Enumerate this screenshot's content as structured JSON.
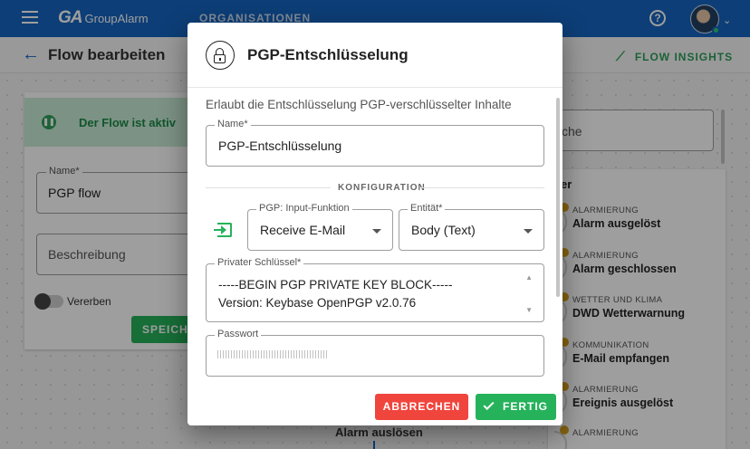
{
  "topbar": {
    "logo_mark": "GA",
    "logo_word": "GroupAlarm",
    "org_label": "ORGANISATIONEN",
    "help_glyph": "?",
    "avatar_caret": "⌄"
  },
  "subheader": {
    "back_glyph": "←",
    "title": "Flow bearbeiten",
    "insights_label": "FLOW INSIGHTS",
    "insights_glyph": "⟋"
  },
  "background": {
    "active_banner": "Der Flow ist aktiv",
    "name_label": "Name*",
    "name_value": "PGP flow",
    "desc_placeholder": "Beschreibung",
    "inherit_label": "Vererben",
    "save_label": "SPEICH",
    "search_partial": "che",
    "triggers_header": "er",
    "triggers": [
      {
        "category": "ALARMIERUNG",
        "name": "Alarm ausgelöst"
      },
      {
        "category": "ALARMIERUNG",
        "name": "Alarm geschlossen"
      },
      {
        "category": "WETTER UND KLIMA",
        "name": "DWD Wetterwarnung"
      },
      {
        "category": "KOMMUNIKATION",
        "name": "E-Mail empfangen"
      },
      {
        "category": "ALARMIERUNG",
        "name": "Ereignis ausgelöst"
      },
      {
        "category": "ALARMIERUNG",
        "name": ""
      }
    ],
    "node_label": "Alarm auslösen"
  },
  "dialog": {
    "title": "PGP-Entschlüsselung",
    "description": "Erlaubt die Entschlüsselung PGP-verschlüsselter Inhalte",
    "name_label": "Name*",
    "name_value": "PGP-Entschlüsselung",
    "section_label": "KONFIGURATION",
    "input_function_label": "PGP: Input-Funktion",
    "input_function_value": "Receive E-Mail",
    "entity_label": "Entität*",
    "entity_value": "Body (Text)",
    "private_key_label": "Privater Schlüssel*",
    "private_key_line1": "-----BEGIN PGP PRIVATE KEY BLOCK-----",
    "private_key_line2": "Version: Keybase OpenPGP v2.0.76",
    "password_label": "Passwort",
    "cancel_label": "ABBRECHEN",
    "done_label": "FERTIG"
  },
  "colors": {
    "primary": "#1565c0",
    "success": "#26b25a",
    "danger": "#f0453d",
    "badge": "#d9a21b"
  }
}
